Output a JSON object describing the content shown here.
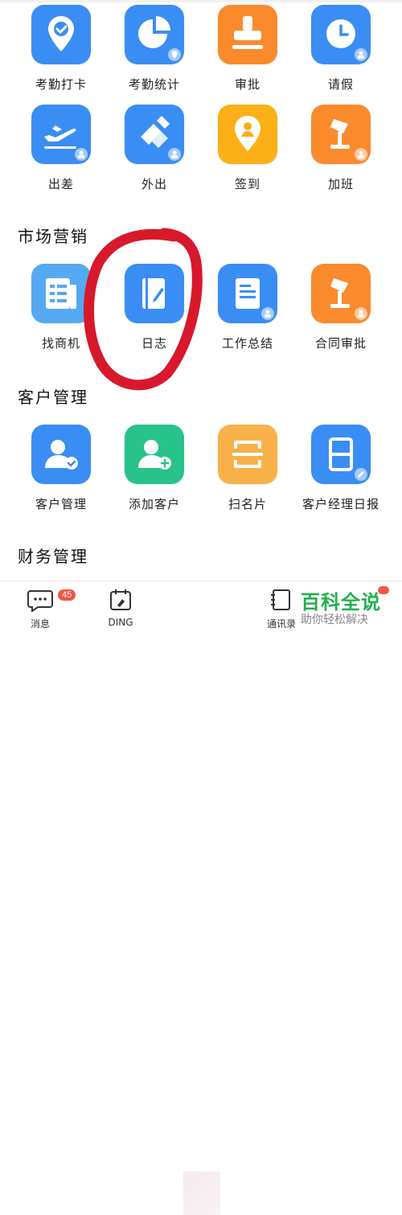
{
  "sections": {
    "s1": "市场营销",
    "s2": "客户管理",
    "s3": "财务管理"
  },
  "row1": [
    {
      "label": "考勤打卡",
      "color": "#3a8df3",
      "icon": "location-check-icon"
    },
    {
      "label": "考勤统计",
      "color": "#3a8df3",
      "icon": "pie-chart-icon"
    },
    {
      "label": "审批",
      "color": "#fa8a2c",
      "icon": "stamp-icon"
    },
    {
      "label": "请假",
      "color": "#3a8df3",
      "icon": "clock-icon"
    }
  ],
  "row2": [
    {
      "label": "出差",
      "color": "#3a8df3",
      "icon": "airplane-icon"
    },
    {
      "label": "外出",
      "color": "#3a8df3",
      "icon": "go-out-icon"
    },
    {
      "label": "签到",
      "color": "#fbb017",
      "icon": "checkin-pin-icon"
    },
    {
      "label": "加班",
      "color": "#fa8a2c",
      "icon": "desk-lamp-icon"
    }
  ],
  "row3": [
    {
      "label": "找商机",
      "color": "#55a9f2",
      "icon": "business-directory-icon"
    },
    {
      "label": "日志",
      "color": "#3a8df3",
      "icon": "journal-edit-icon"
    },
    {
      "label": "工作总结",
      "color": "#3a8df3",
      "icon": "document-icon"
    },
    {
      "label": "合同审批",
      "color": "#fa8a2c",
      "icon": "desk-lamp-icon"
    }
  ],
  "row4": [
    {
      "label": "客户管理",
      "color": "#3a8df3",
      "icon": "customer-check-icon"
    },
    {
      "label": "添加客户",
      "color": "#27c38a",
      "icon": "add-customer-icon"
    },
    {
      "label": "扫名片",
      "color": "#f9b14a",
      "icon": "scan-card-icon"
    },
    {
      "label": "客户经理日报",
      "color": "#3a8df3",
      "icon": "daily-report-icon"
    }
  ],
  "tabs": {
    "messages": "消息",
    "messages_badge": "45",
    "ding": "DING",
    "contacts": "通讯录"
  },
  "watermark": {
    "title": "百科全说",
    "subtitle": "助你轻松解决"
  }
}
